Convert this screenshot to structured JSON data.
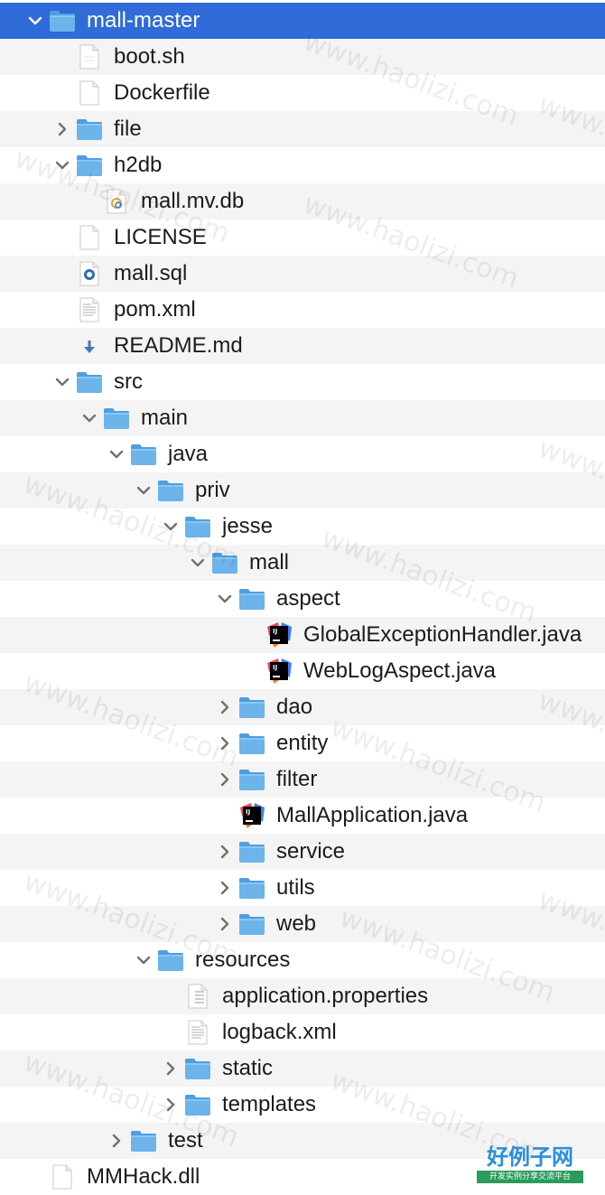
{
  "colors": {
    "selection": "#2f6bd9",
    "folder": "#6cb4ea",
    "alt_row": "#f4f4f5",
    "text": "#1b1b1b"
  },
  "tree": {
    "items": [
      {
        "label": "mall-master",
        "depth": 0,
        "kind": "folder",
        "expanded": true,
        "selected": true
      },
      {
        "label": "boot.sh",
        "depth": 1,
        "kind": "file-doc"
      },
      {
        "label": "Dockerfile",
        "depth": 1,
        "kind": "file-blank"
      },
      {
        "label": "file",
        "depth": 1,
        "kind": "folder",
        "expanded": false
      },
      {
        "label": "h2db",
        "depth": 1,
        "kind": "folder",
        "expanded": true
      },
      {
        "label": "mall.mv.db",
        "depth": 2,
        "kind": "file-db"
      },
      {
        "label": "LICENSE",
        "depth": 1,
        "kind": "file-blank"
      },
      {
        "label": "mall.sql",
        "depth": 1,
        "kind": "file-sql"
      },
      {
        "label": "pom.xml",
        "depth": 1,
        "kind": "file-text"
      },
      {
        "label": "README.md",
        "depth": 1,
        "kind": "file-md"
      },
      {
        "label": "src",
        "depth": 1,
        "kind": "folder",
        "expanded": true
      },
      {
        "label": "main",
        "depth": 2,
        "kind": "folder",
        "expanded": true
      },
      {
        "label": "java",
        "depth": 3,
        "kind": "folder",
        "expanded": true
      },
      {
        "label": "priv",
        "depth": 4,
        "kind": "folder",
        "expanded": true
      },
      {
        "label": "jesse",
        "depth": 5,
        "kind": "folder",
        "expanded": true
      },
      {
        "label": "mall",
        "depth": 6,
        "kind": "folder",
        "expanded": true
      },
      {
        "label": "aspect",
        "depth": 7,
        "kind": "folder",
        "expanded": true
      },
      {
        "label": "GlobalExceptionHandler.java",
        "depth": 8,
        "kind": "file-java"
      },
      {
        "label": "WebLogAspect.java",
        "depth": 8,
        "kind": "file-java"
      },
      {
        "label": "dao",
        "depth": 7,
        "kind": "folder",
        "expanded": false
      },
      {
        "label": "entity",
        "depth": 7,
        "kind": "folder",
        "expanded": false
      },
      {
        "label": "filter",
        "depth": 7,
        "kind": "folder",
        "expanded": false
      },
      {
        "label": "MallApplication.java",
        "depth": 7,
        "kind": "file-java"
      },
      {
        "label": "service",
        "depth": 7,
        "kind": "folder",
        "expanded": false
      },
      {
        "label": "utils",
        "depth": 7,
        "kind": "folder",
        "expanded": false
      },
      {
        "label": "web",
        "depth": 7,
        "kind": "folder",
        "expanded": false
      },
      {
        "label": "resources",
        "depth": 4,
        "kind": "folder",
        "expanded": true
      },
      {
        "label": "application.properties",
        "depth": 5,
        "kind": "file-props"
      },
      {
        "label": "logback.xml",
        "depth": 5,
        "kind": "file-text"
      },
      {
        "label": "static",
        "depth": 5,
        "kind": "folder",
        "expanded": false
      },
      {
        "label": "templates",
        "depth": 5,
        "kind": "folder",
        "expanded": false
      },
      {
        "label": "test",
        "depth": 3,
        "kind": "folder",
        "expanded": false
      },
      {
        "label": "MMHack.dll",
        "depth": 0,
        "kind": "file-blank"
      }
    ]
  },
  "watermark": {
    "text": "www.haolizi.com",
    "logo_main": "好例子网",
    "logo_sub": "开发实例分享交流平台"
  }
}
